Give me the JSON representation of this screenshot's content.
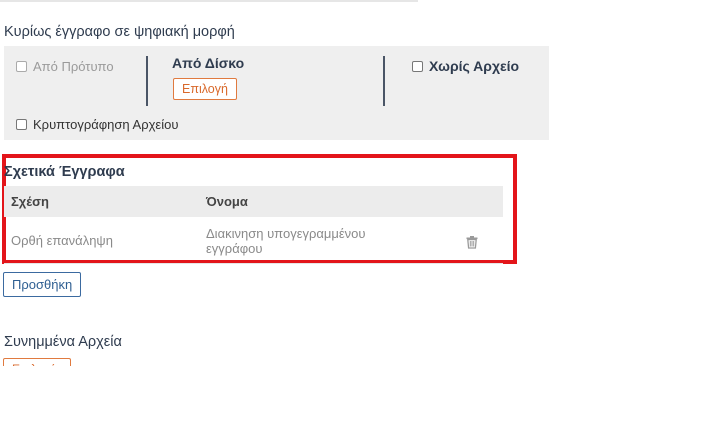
{
  "main_section": {
    "title": "Κυρίως έγγραφο σε ψηφιακή μορφή",
    "from_template_label": "Από Πρότυπο",
    "from_disk_title": "Από Δίσκο",
    "choose_label": "Επιλογή",
    "no_file_label": "Χωρίς Αρχείο",
    "encrypt_label": "Κρυπτογράφηση Αρχείου"
  },
  "related_section": {
    "title": "Σχετικά Έγγραφα",
    "columns": [
      "Σχέση",
      "Όνομα"
    ],
    "rows": [
      {
        "relation": "Ορθή επανάληψη",
        "name_line1": "Διακινηση υπογεγραμμένου",
        "name_line2": "εγγράφου"
      }
    ],
    "add_label": "Προσθήκη"
  },
  "attached_section": {
    "title": "Συνημμένα Αρχεία",
    "choose_label": "Επιλογή"
  },
  "colors": {
    "highlight": "#e3151a",
    "accent_orange": "#e07a3f",
    "accent_blue": "#3b6aa0"
  }
}
